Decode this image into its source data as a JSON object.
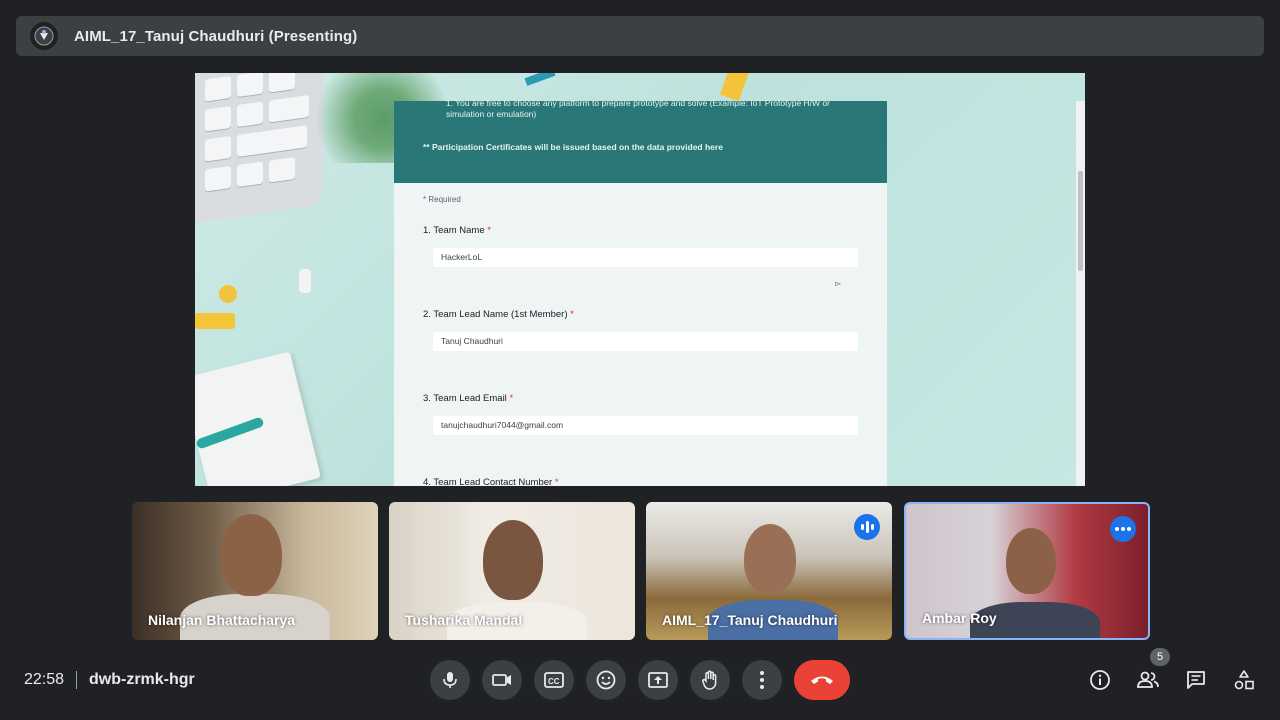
{
  "topbar": {
    "title": "AIML_17_Tanuj Chaudhuri (Presenting)",
    "icon": "presenter-avatar-icon"
  },
  "presentation": {
    "form": {
      "header_line1": "1. You are free to choose any platform to prepare prototype and solve (Example: IoT Prototype H/W or",
      "header_line2": "simulation or emulation)",
      "note": "** Participation Certificates will be issued based on the data provided here",
      "required": "* Required",
      "questions": [
        {
          "label": "1. Team Name",
          "star": "*",
          "answer": "HackerLoL"
        },
        {
          "label": "2. Team Lead Name (1st Member)",
          "star": "*",
          "answer": "Tanuj Chaudhuri"
        },
        {
          "label": "3. Team Lead Email",
          "star": "*",
          "answer": "tanujchaudhuri7044@gmail.com"
        },
        {
          "label": "4. Team Lead Contact Number",
          "star": "*",
          "answer": ""
        }
      ]
    }
  },
  "participants": [
    {
      "name": "Nilanjan Bhattacharya",
      "badge": ""
    },
    {
      "name": "Tusharika Mandal",
      "badge": ""
    },
    {
      "name": "AIML_17_Tanuj Chaudhuri",
      "badge": "speaking"
    },
    {
      "name": "Ambar Roy",
      "badge": "more"
    }
  ],
  "bottombar": {
    "time": "22:58",
    "meeting_code": "dwb-zrmk-hgr",
    "participant_count": "5",
    "controls": [
      "microphone-icon",
      "camera-icon",
      "captions-icon",
      "emoji-icon",
      "present-icon",
      "raise-hand-icon",
      "more-options-icon",
      "end-call-icon"
    ],
    "right": [
      "info-icon",
      "people-icon",
      "chat-icon",
      "activities-icon"
    ]
  },
  "colors": {
    "background": "#202124",
    "topbar": "#3c4043",
    "end_call": "#ea4335",
    "accent": "#1a73e8",
    "form_header": "#2a7778"
  }
}
